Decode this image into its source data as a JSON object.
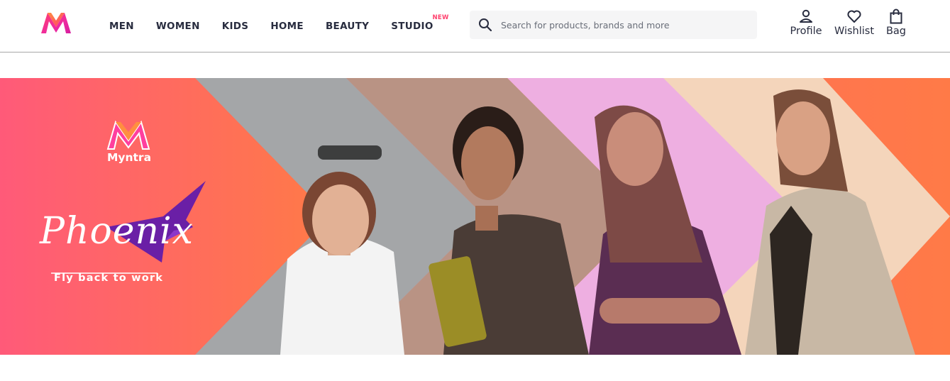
{
  "header": {
    "logo_icon": "myntra-logo-icon",
    "nav": [
      {
        "label": "MEN"
      },
      {
        "label": "WOMEN"
      },
      {
        "label": "KIDS"
      },
      {
        "label": "HOME"
      },
      {
        "label": "BEAUTY"
      },
      {
        "label": "STUDIO",
        "badge": "NEW"
      }
    ],
    "search": {
      "placeholder": "Search for products, brands and more",
      "value": "",
      "icon": "search-icon"
    },
    "actions": [
      {
        "label": "Profile",
        "icon": "person-icon"
      },
      {
        "label": "Wishlist",
        "icon": "heart-icon"
      },
      {
        "label": "Bag",
        "icon": "bag-icon"
      }
    ]
  },
  "banner": {
    "brand": "Myntra",
    "title": "Phoenix",
    "tagline": "Fly back to work",
    "colors": {
      "coral_left": "#ff5a79",
      "coral_right": "#ff7a47",
      "grey": "#a4a6a8",
      "brown": "#b99384",
      "pink": "#eeafe1",
      "peach": "#f4d5bb"
    }
  },
  "colors": {
    "accent": "#ff3f6c",
    "text": "#282c3f",
    "search_bg": "#f5f5f6"
  }
}
